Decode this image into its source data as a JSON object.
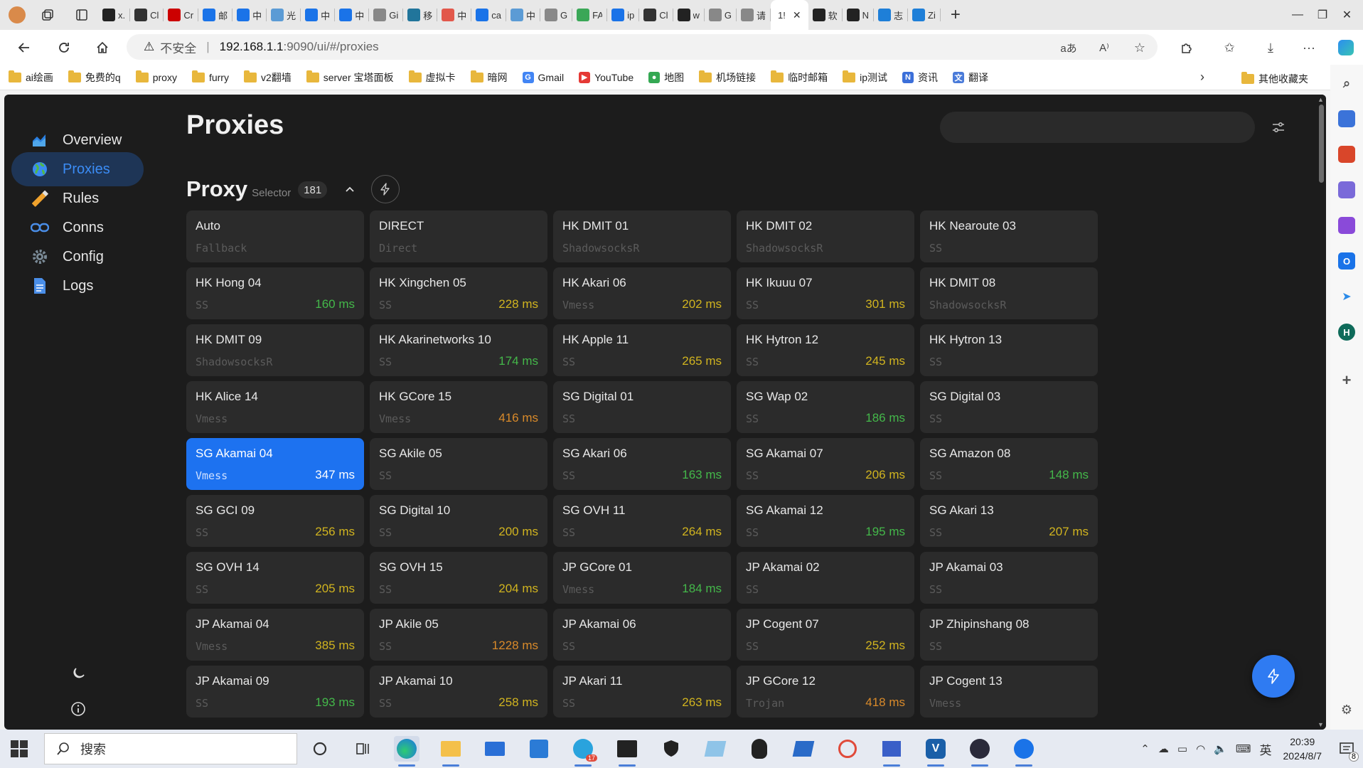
{
  "browser": {
    "tabs": [
      {
        "title": "x.",
        "icon": "x-icon",
        "color": "#222"
      },
      {
        "title": "Cl",
        "icon": "openai-icon",
        "color": "#333"
      },
      {
        "title": "Cr",
        "icon": "red-square-icon",
        "color": "#c00"
      },
      {
        "title": "邮",
        "icon": "outlook-icon",
        "color": "#1a73e8"
      },
      {
        "title": "中",
        "icon": "search-icon",
        "color": "#1a73e8"
      },
      {
        "title": "光",
        "icon": "sword-icon",
        "color": "#5b9bd5"
      },
      {
        "title": "中",
        "icon": "search-icon",
        "color": "#1a73e8"
      },
      {
        "title": "中",
        "icon": "search-icon",
        "color": "#1a73e8"
      },
      {
        "title": "Gi",
        "icon": "page-icon",
        "color": "#888"
      },
      {
        "title": "移",
        "icon": "wordpress-icon",
        "color": "#21759b"
      },
      {
        "title": "中",
        "icon": "c-icon",
        "color": "#e2584b"
      },
      {
        "title": "ca",
        "icon": "search-icon",
        "color": "#1a73e8"
      },
      {
        "title": "中",
        "icon": "sword-icon",
        "color": "#5b9bd5"
      },
      {
        "title": "G",
        "icon": "page-icon",
        "color": "#888"
      },
      {
        "title": "FA",
        "icon": "f-icon",
        "color": "#3aa757"
      },
      {
        "title": "ip",
        "icon": "search-icon",
        "color": "#1a73e8"
      },
      {
        "title": "Cl",
        "icon": "openai-icon",
        "color": "#333"
      },
      {
        "title": "w",
        "icon": "github-icon",
        "color": "#222"
      },
      {
        "title": "G",
        "icon": "page-icon",
        "color": "#888"
      },
      {
        "title": "请",
        "icon": "page-icon",
        "color": "#888"
      }
    ],
    "active_tab": {
      "title": "1!",
      "close": "✕"
    },
    "tabs_after": [
      {
        "title": "软",
        "icon": "dot-icon",
        "color": "#222"
      },
      {
        "title": "N",
        "icon": "dot-icon",
        "color": "#222"
      },
      {
        "title": "志",
        "icon": "ch-icon",
        "color": "#1e7fd8"
      },
      {
        "title": "Zi",
        "icon": "ch-icon",
        "color": "#1e7fd8"
      }
    ],
    "new_tab": "+",
    "address": {
      "warning": "不安全",
      "separator": "|",
      "host": "192.168.1.1",
      "path": ":9090/ui/#/proxies"
    },
    "bookmarks": [
      {
        "label": "ai绘画",
        "type": "folder"
      },
      {
        "label": "免费的q",
        "type": "folder"
      },
      {
        "label": "proxy",
        "type": "folder"
      },
      {
        "label": "furry",
        "type": "folder"
      },
      {
        "label": "v2翻墙",
        "type": "folder"
      },
      {
        "label": "server 宝塔面板",
        "type": "folder"
      },
      {
        "label": "虚拟卡",
        "type": "folder"
      },
      {
        "label": "暗网",
        "type": "folder"
      },
      {
        "label": "Gmail",
        "type": "google"
      },
      {
        "label": "YouTube",
        "type": "youtube"
      },
      {
        "label": "地图",
        "type": "maps"
      },
      {
        "label": "机场链接",
        "type": "folder"
      },
      {
        "label": "临时邮箱",
        "type": "folder"
      },
      {
        "label": "ip测试",
        "type": "folder"
      },
      {
        "label": "资讯",
        "type": "news"
      },
      {
        "label": "翻译",
        "type": "translate"
      }
    ],
    "other_bookmarks": "其他收藏夹"
  },
  "app": {
    "nav": [
      {
        "label": "Overview",
        "id": "overview",
        "color": "#2a7fe0"
      },
      {
        "label": "Proxies",
        "id": "proxies",
        "color": "#3b8cf5"
      },
      {
        "label": "Rules",
        "id": "rules",
        "color": "#f0a22d"
      },
      {
        "label": "Conns",
        "id": "conns",
        "color": "#4a8ee8"
      },
      {
        "label": "Config",
        "id": "config",
        "color": "#7a8a96"
      },
      {
        "label": "Logs",
        "id": "logs",
        "color": "#4a8ee8"
      }
    ],
    "active_nav": "proxies",
    "page_title": "Proxies",
    "search_placeholder": "",
    "group": {
      "name": "Proxy",
      "type": "Selector",
      "count": "181"
    }
  },
  "proxies": [
    {
      "name": "Auto",
      "type": "Fallback",
      "delay": ""
    },
    {
      "name": "DIRECT",
      "type": "Direct",
      "delay": ""
    },
    {
      "name": "HK DMIT 01",
      "type": "ShadowsocksR",
      "delay": ""
    },
    {
      "name": "HK DMIT 02",
      "type": "ShadowsocksR",
      "delay": ""
    },
    {
      "name": "HK Nearoute 03",
      "type": "SS",
      "delay": ""
    },
    {
      "name": "HK Hong 04",
      "type": "SS",
      "delay": "160 ms"
    },
    {
      "name": "HK Xingchen 05",
      "type": "SS",
      "delay": "228 ms"
    },
    {
      "name": "HK Akari 06",
      "type": "Vmess",
      "delay": "202 ms"
    },
    {
      "name": "HK Ikuuu 07",
      "type": "SS",
      "delay": "301 ms"
    },
    {
      "name": "HK DMIT 08",
      "type": "ShadowsocksR",
      "delay": ""
    },
    {
      "name": "HK DMIT 09",
      "type": "ShadowsocksR",
      "delay": ""
    },
    {
      "name": "HK Akarinetworks 10",
      "type": "SS",
      "delay": "174 ms"
    },
    {
      "name": "HK Apple 11",
      "type": "SS",
      "delay": "265 ms"
    },
    {
      "name": "HK Hytron 12",
      "type": "SS",
      "delay": "245 ms"
    },
    {
      "name": "HK Hytron 13",
      "type": "SS",
      "delay": ""
    },
    {
      "name": "HK Alice 14",
      "type": "Vmess",
      "delay": ""
    },
    {
      "name": "HK GCore 15",
      "type": "Vmess",
      "delay": "416 ms"
    },
    {
      "name": "SG Digital 01",
      "type": "SS",
      "delay": ""
    },
    {
      "name": "SG Wap 02",
      "type": "SS",
      "delay": "186 ms"
    },
    {
      "name": "SG Digital 03",
      "type": "SS",
      "delay": ""
    },
    {
      "name": "SG Akamai 04",
      "type": "Vmess",
      "delay": "347 ms",
      "selected": true
    },
    {
      "name": "SG Akile 05",
      "type": "SS",
      "delay": ""
    },
    {
      "name": "SG Akari 06",
      "type": "SS",
      "delay": "163 ms"
    },
    {
      "name": "SG Akamai 07",
      "type": "SS",
      "delay": "206 ms"
    },
    {
      "name": "SG Amazon 08",
      "type": "SS",
      "delay": "148 ms"
    },
    {
      "name": "SG GCI 09",
      "type": "SS",
      "delay": "256 ms"
    },
    {
      "name": "SG Digital 10",
      "type": "SS",
      "delay": "200 ms"
    },
    {
      "name": "SG OVH 11",
      "type": "SS",
      "delay": "264 ms"
    },
    {
      "name": "SG Akamai 12",
      "type": "SS",
      "delay": "195 ms"
    },
    {
      "name": "SG Akari 13",
      "type": "SS",
      "delay": "207 ms"
    },
    {
      "name": "SG OVH 14",
      "type": "SS",
      "delay": "205 ms"
    },
    {
      "name": "SG OVH 15",
      "type": "SS",
      "delay": "204 ms"
    },
    {
      "name": "JP GCore 01",
      "type": "Vmess",
      "delay": "184 ms"
    },
    {
      "name": "JP Akamai 02",
      "type": "SS",
      "delay": ""
    },
    {
      "name": "JP Akamai 03",
      "type": "SS",
      "delay": ""
    },
    {
      "name": "JP Akamai 04",
      "type": "Vmess",
      "delay": "385 ms"
    },
    {
      "name": "JP Akile 05",
      "type": "SS",
      "delay": "1228 ms"
    },
    {
      "name": "JP Akamai 06",
      "type": "SS",
      "delay": ""
    },
    {
      "name": "JP Cogent 07",
      "type": "SS",
      "delay": "252 ms"
    },
    {
      "name": "JP Zhipinshang 08",
      "type": "SS",
      "delay": ""
    },
    {
      "name": "JP Akamai 09",
      "type": "SS",
      "delay": "193 ms"
    },
    {
      "name": "JP Akamai 10",
      "type": "SS",
      "delay": "258 ms"
    },
    {
      "name": "JP Akari 11",
      "type": "SS",
      "delay": "263 ms"
    },
    {
      "name": "JP GCore 12",
      "type": "Trojan",
      "delay": "418 ms"
    },
    {
      "name": "JP Cogent 13",
      "type": "Vmess",
      "delay": ""
    }
  ],
  "taskbar": {
    "search_label": "搜索",
    "time": "20:39",
    "date": "2024/8/7",
    "ime": "英",
    "notification_count": "8",
    "telegram_badge": "17"
  },
  "colors": {
    "accent": "#1d72f0",
    "fast": "#44b84a",
    "mid": "#d1b41f",
    "slow": "#d98a2a"
  }
}
